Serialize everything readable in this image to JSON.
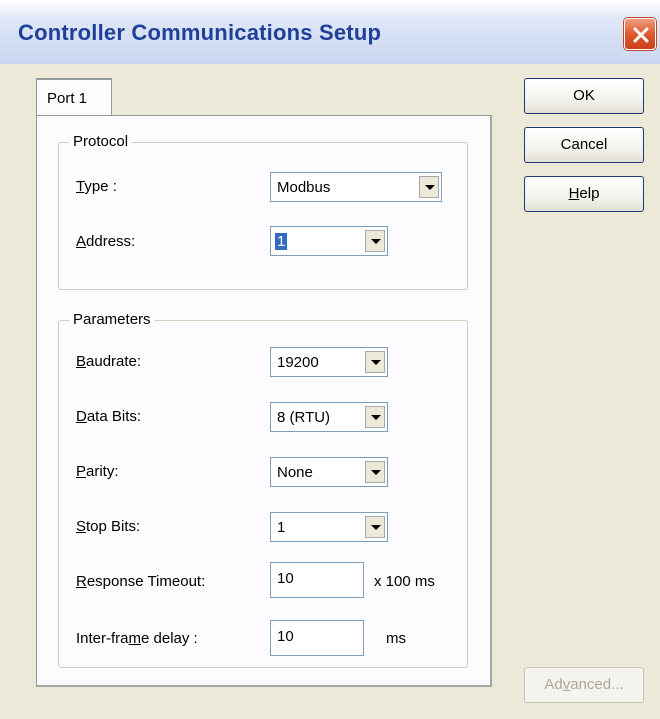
{
  "window": {
    "title": "Controller Communications Setup",
    "close_icon": "close-icon"
  },
  "tabs": [
    {
      "label": "Port 1",
      "selected": true
    }
  ],
  "protocol": {
    "group_label": "Protocol",
    "type": {
      "label_mnemonic": "T",
      "label_rest": "ype :",
      "value": "Modbus"
    },
    "address": {
      "label_mnemonic": "A",
      "label_rest": "ddress:",
      "value": "1"
    }
  },
  "parameters": {
    "group_label": "Parameters",
    "baudrate": {
      "label_mnemonic": "B",
      "label_rest": "audrate:",
      "value": "19200"
    },
    "data_bits": {
      "label_mnemonic": "D",
      "label_rest": "ata Bits:",
      "value": "8 (RTU)"
    },
    "parity": {
      "label_mnemonic": "P",
      "label_rest": "arity:",
      "value": "None"
    },
    "stop_bits": {
      "label_mnemonic": "S",
      "label_rest": "top Bits:",
      "value": "1"
    },
    "response_timeout": {
      "label_mnemonic": "R",
      "label_rest": "esponse Timeout:",
      "value": "10",
      "unit": "x 100 ms"
    },
    "interframe_delay": {
      "label_before": "Inter-fra",
      "label_mnemonic": "m",
      "label_after": "e delay :",
      "value": "10",
      "unit": "ms"
    }
  },
  "buttons": {
    "ok": "OK",
    "cancel": "Cancel",
    "help_mnemonic": "H",
    "help_rest": "elp",
    "advanced_before": "Ad",
    "advanced_mnemonic": "v",
    "advanced_after": "anced..."
  },
  "colors": {
    "title_text": "#1f3f99",
    "dialog_bg": "#ece9d8",
    "selection": "#316ac5",
    "close_button": "#e0552b"
  }
}
